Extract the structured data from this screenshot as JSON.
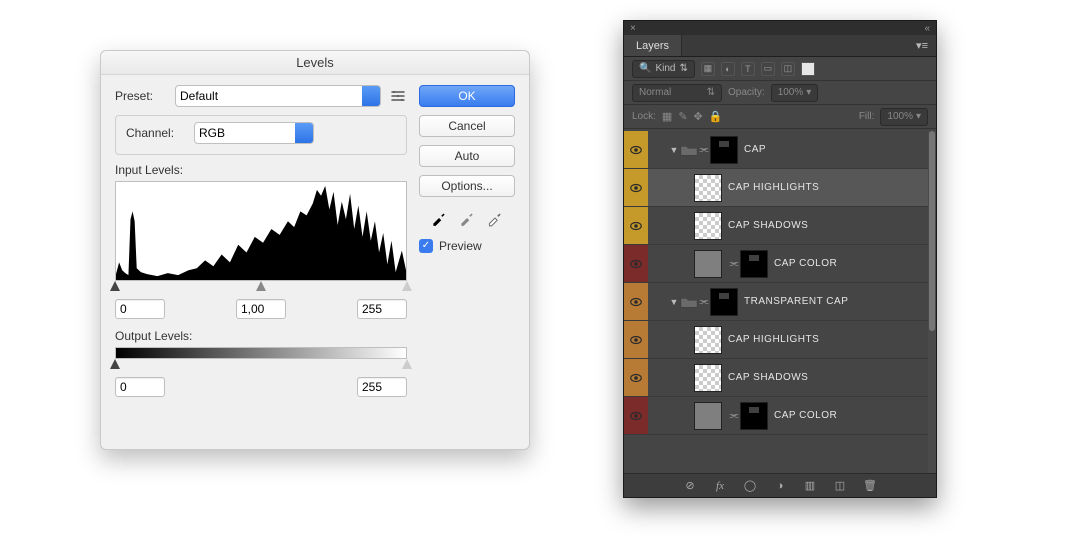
{
  "levels": {
    "title": "Levels",
    "preset_label": "Preset:",
    "preset_value": "Default",
    "channel_label": "Channel:",
    "channel_value": "RGB",
    "input_label": "Input Levels:",
    "output_label": "Output Levels:",
    "in_black": "0",
    "in_gamma": "1,00",
    "in_white": "255",
    "out_black": "0",
    "out_white": "255",
    "ok": "OK",
    "cancel": "Cancel",
    "auto": "Auto",
    "options": "Options...",
    "preview_label": "Preview",
    "preview_checked": true
  },
  "layersPanel": {
    "tab": "Layers",
    "kind_label": "Kind",
    "blend_mode": "Normal",
    "opacity_label": "Opacity:",
    "opacity_value": "100%",
    "lock_label": "Lock:",
    "fill_label": "Fill:",
    "fill_value": "100%",
    "items": [
      {
        "name": "CAP",
        "type": "group",
        "color": "yellow",
        "depth": 0
      },
      {
        "name": "CAP HIGHLIGHTS",
        "type": "layer",
        "color": "yellow",
        "depth": 1,
        "selected": true
      },
      {
        "name": "CAP SHADOWS",
        "type": "layer",
        "color": "yellow",
        "depth": 1
      },
      {
        "name": "CAP COLOR",
        "type": "fill",
        "color": "red",
        "depth": 1
      },
      {
        "name": "TRANSPARENT CAP",
        "type": "group",
        "color": "orange",
        "depth": 0
      },
      {
        "name": "CAP HIGHLIGHTS",
        "type": "layer",
        "color": "orange",
        "depth": 1
      },
      {
        "name": "CAP SHADOWS",
        "type": "layer",
        "color": "orange",
        "depth": 1
      },
      {
        "name": "CAP COLOR",
        "type": "fill",
        "color": "red",
        "depth": 1
      }
    ]
  }
}
